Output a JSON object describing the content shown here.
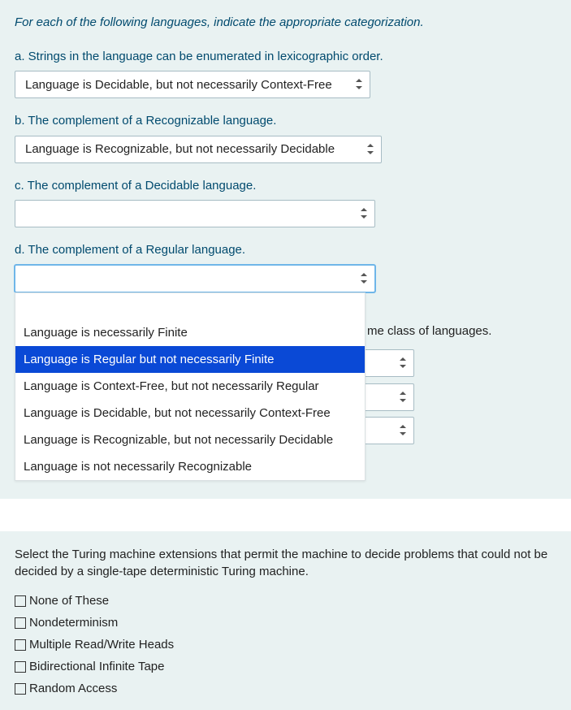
{
  "q1": {
    "instruction": "For each of the following languages, indicate the appropriate categorization.",
    "items": {
      "a": {
        "label": "a. Strings in the language can be enumerated in lexicographic order.",
        "value": "Language is Decidable, but not necessarily Context-Free"
      },
      "b": {
        "label": "b. The complement of a Recognizable language.",
        "value": "Language is Recognizable, but not necessarily Decidable"
      },
      "c": {
        "label": "c. The complement of a Decidable language.",
        "value": ""
      },
      "d": {
        "label": "d. The complement of a Regular language.",
        "value": ""
      }
    },
    "options": [
      "Language is necessarily Finite",
      "Language is Regular but not necessarily Finite",
      "Language is Context-Free, but not necessarily Regular",
      "Language is Decidable, but not necessarily Context-Free",
      "Language is Recognizable, but not necessarily Decidable",
      "Language is not necessarily Recognizable"
    ],
    "highlighted_index": 1,
    "obscured_tail": "me class of languages."
  },
  "q2": {
    "prompt": "Select the Turing machine extensions that permit the machine to decide problems that could not be decided by a single-tape deterministic Turing machine.",
    "options": [
      "None of These",
      "Nondeterminism",
      "Multiple Read/Write Heads",
      "Bidirectional Infinite Tape",
      "Random Access"
    ]
  }
}
